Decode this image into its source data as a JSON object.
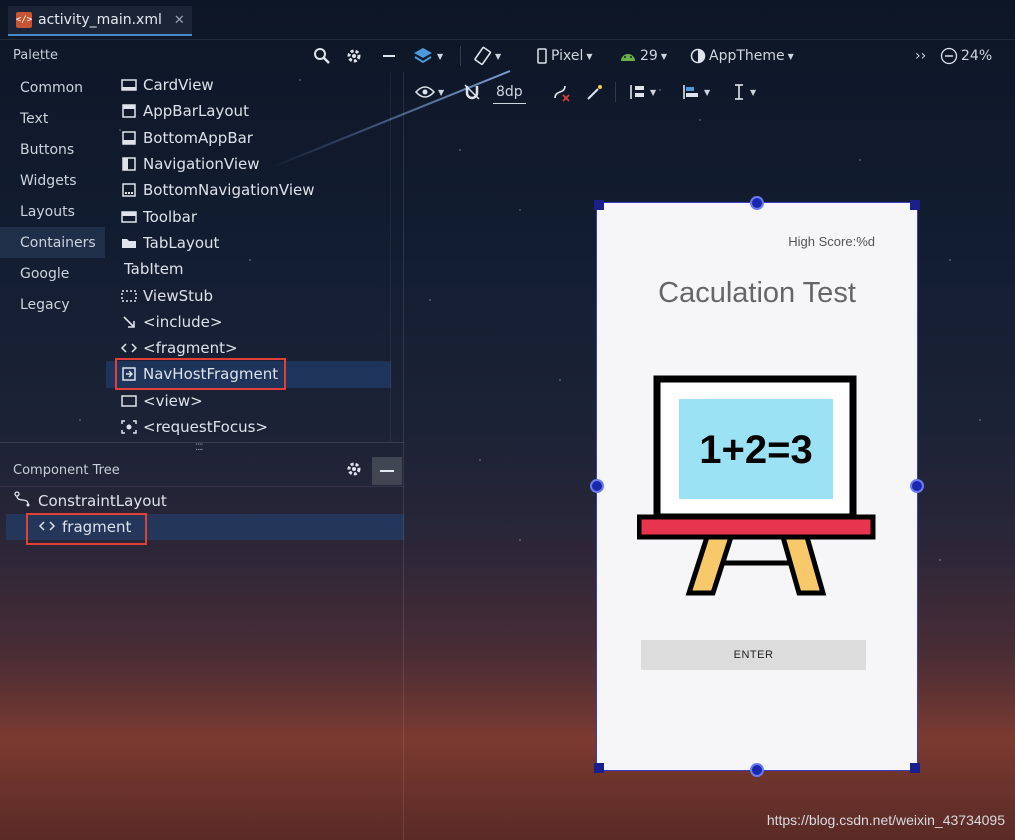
{
  "tab": {
    "title": "activity_main.xml",
    "close": "✕",
    "icon_text": "</>"
  },
  "palette": {
    "label": "Palette",
    "categories": [
      "Common",
      "Text",
      "Buttons",
      "Widgets",
      "Layouts",
      "Containers",
      "Google",
      "Legacy"
    ],
    "active_category": "Containers",
    "items": [
      {
        "label": "CardView",
        "icon": "card-icon"
      },
      {
        "label": "AppBarLayout",
        "icon": "appbar-icon"
      },
      {
        "label": "BottomAppBar",
        "icon": "bottom-appbar-icon"
      },
      {
        "label": "NavigationView",
        "icon": "navigation-view-icon"
      },
      {
        "label": "BottomNavigationView",
        "icon": "bottom-navigation-icon"
      },
      {
        "label": "Toolbar",
        "icon": "toolbar-icon"
      },
      {
        "label": "TabLayout",
        "icon": "folder-icon"
      },
      {
        "label": "TabItem",
        "icon": ""
      },
      {
        "label": "ViewStub",
        "icon": "viewstub-icon"
      },
      {
        "label": "<include>",
        "icon": "include-arrow-icon"
      },
      {
        "label": "<fragment>",
        "icon": "code-brackets-icon"
      },
      {
        "label": "NavHostFragment",
        "icon": "navhost-icon"
      },
      {
        "label": "<view>",
        "icon": "view-icon"
      },
      {
        "label": "<requestFocus>",
        "icon": "focus-icon"
      }
    ],
    "selected_item": "NavHostFragment"
  },
  "toolbar": {
    "device": "Pixel",
    "api": "29",
    "theme": "AppTheme",
    "zoom": "24%",
    "margin": "8dp",
    "overflow": "››"
  },
  "component_tree": {
    "title": "Component Tree",
    "root": "ConstraintLayout",
    "child": "fragment"
  },
  "preview": {
    "high_score": "High Score:%d",
    "title": "Caculation Test",
    "board_text": "1+2=3",
    "button": "ENTER"
  },
  "watermark": "https://blog.csdn.net/weixin_43734095",
  "colors": {
    "accent": "#4a88c7",
    "highlight_box": "#e0403a",
    "board_screen": "#9be3f4",
    "board_shelf": "#e8354f",
    "easel_legs": "#f7c96a"
  }
}
